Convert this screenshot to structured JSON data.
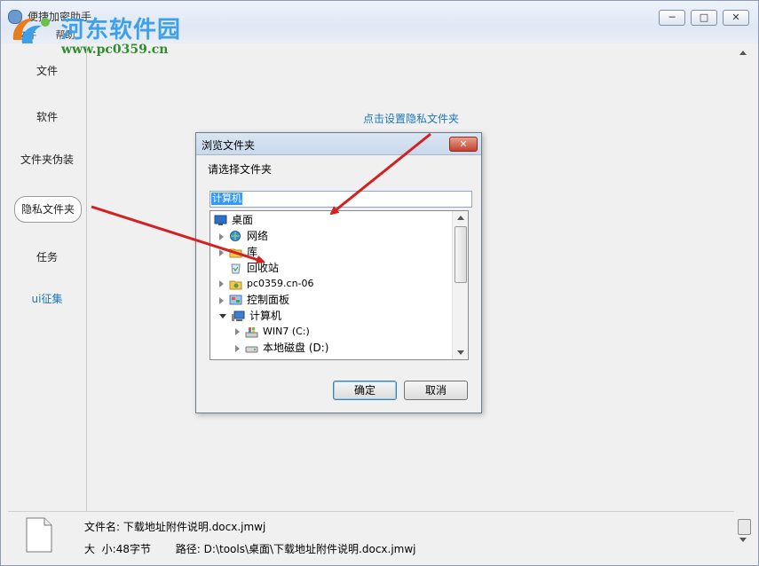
{
  "window": {
    "title": "便捷加密助手"
  },
  "menubar": {
    "items": [
      "文件",
      "帮助"
    ]
  },
  "wm": {
    "minimize": "─",
    "maximize": "□",
    "close": "✕"
  },
  "watermark": {
    "text": "河东软件园",
    "url": "www.pc0359.cn"
  },
  "sidebar": {
    "items": [
      {
        "label": "文件"
      },
      {
        "label": "软件"
      },
      {
        "label": "文件夹伪装"
      },
      {
        "label": "隐私文件夹"
      },
      {
        "label": "任务"
      },
      {
        "label": "ui征集"
      }
    ]
  },
  "annotation": {
    "tip": "点击设置隐私文件夹"
  },
  "dialog": {
    "title": "浏览文件夹",
    "close": "✕",
    "prompt": "请选择文件夹",
    "input_value": "计算机",
    "tree": [
      {
        "label": "桌面",
        "icon": "desktop-icon"
      },
      {
        "label": "网络",
        "icon": "network-icon"
      },
      {
        "label": "库",
        "icon": "library-icon"
      },
      {
        "label": "回收站",
        "icon": "recycle-bin-icon"
      },
      {
        "label": "pc0359.cn-06",
        "icon": "user-folder-icon"
      },
      {
        "label": "控制面板",
        "icon": "control-panel-icon"
      },
      {
        "label": "计算机",
        "icon": "computer-icon"
      },
      {
        "label": "WIN7 (C:)",
        "icon": "system-drive-icon"
      },
      {
        "label": "本地磁盘 (D:)",
        "icon": "disk-drive-icon"
      }
    ],
    "ok": "确定",
    "cancel": "取消"
  },
  "fileinfo": {
    "name_label": "文件名:",
    "name_value": "下载地址附件说明.docx.jmwj",
    "size_label": "大  小:",
    "size_value": "48字节",
    "path_label": "路径:",
    "path_value": "D:\\tools\\桌面\\下载地址附件说明.docx.jmwj"
  },
  "colors": {
    "accent": "#1a77b8",
    "arrow": "#d42020",
    "selection": "#3399ff"
  }
}
